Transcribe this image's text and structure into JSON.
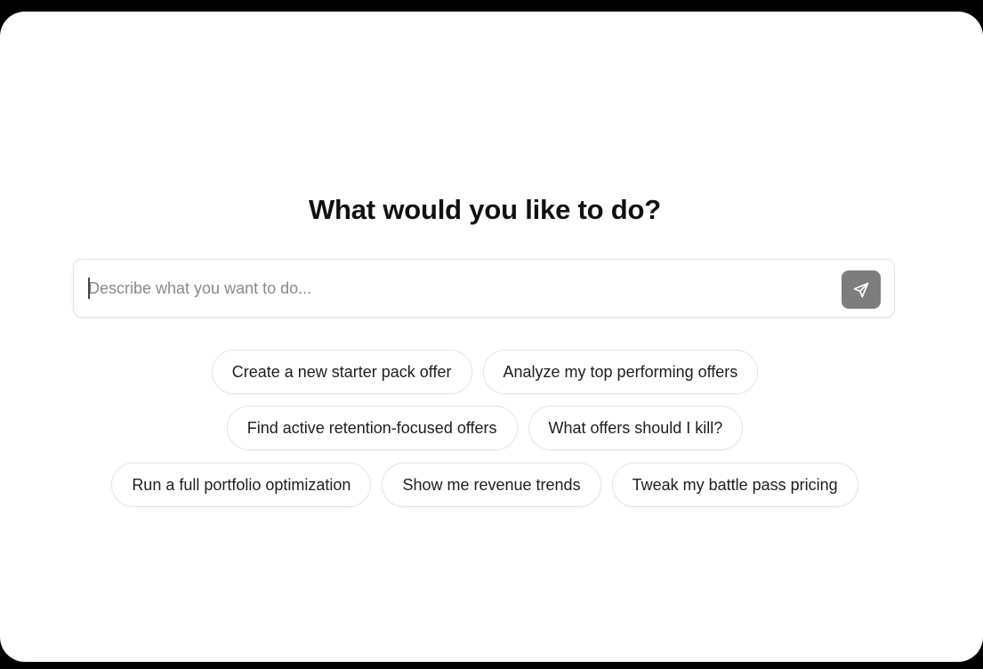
{
  "heading": "What would you like to do?",
  "prompt": {
    "placeholder": "Describe what you want to do...",
    "value": "",
    "send_icon": "send-arrow-icon",
    "send_color": "#7d7d7d"
  },
  "suggestions": {
    "row1": [
      "Create a new starter pack offer",
      "Analyze my top performing offers"
    ],
    "row2": [
      "Find active retention-focused offers",
      "What offers should I kill?"
    ],
    "row3": [
      "Run a full portfolio optimization",
      "Show me revenue trends",
      "Tweak my battle pass pricing"
    ]
  }
}
